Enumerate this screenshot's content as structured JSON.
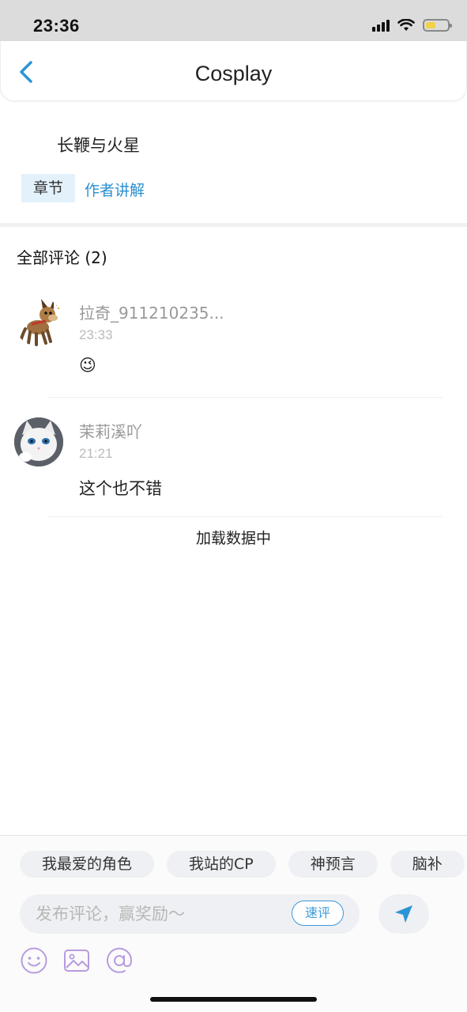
{
  "status_bar": {
    "time": "23:36"
  },
  "nav": {
    "title": "Cosplay"
  },
  "article": {
    "title": "长鞭与火星",
    "tag_chapter": "章节",
    "tag_author": "作者讲解"
  },
  "comments": {
    "header": "全部评论 (2)",
    "items": [
      {
        "name": "拉奇_911210235...",
        "time": "23:33",
        "body": "😉",
        "avatar_icon": "dog-avatar"
      },
      {
        "name": "茉莉溪吖",
        "time": "21:21",
        "body": "这个也不错",
        "avatar_icon": "cat-avatar"
      }
    ],
    "loading": "加载数据中"
  },
  "composer": {
    "chips": [
      "我最爱的角色",
      "我站的CP",
      "神预言",
      "脑补"
    ],
    "placeholder": "发布评论，赢奖励～",
    "quick_label": "速评",
    "accent": "#3a9ad9"
  }
}
